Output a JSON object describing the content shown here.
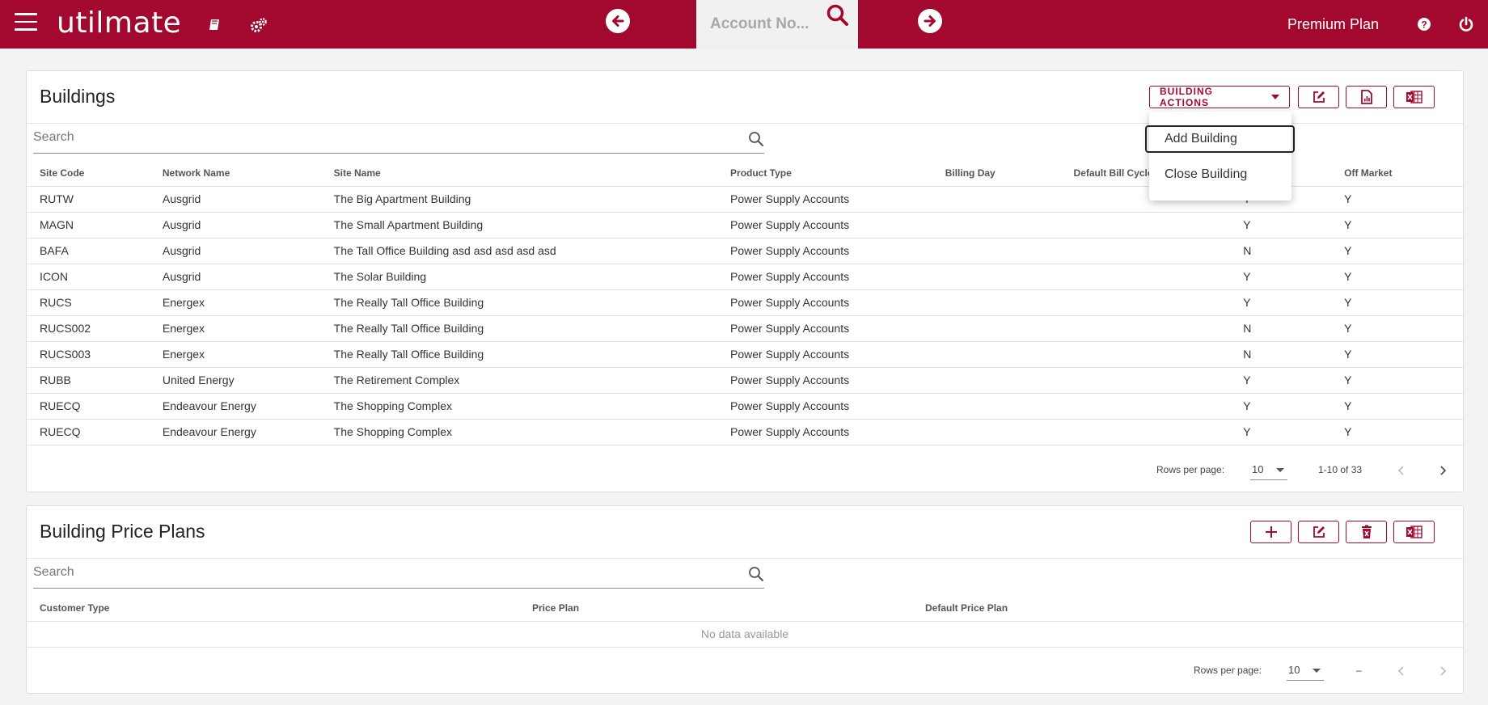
{
  "app": {
    "brand": "utilmate",
    "account_search_placeholder": "Account No...",
    "plan_label": "Premium Plan"
  },
  "buildings": {
    "title": "Buildings",
    "actions_label": "BUILDING ACTIONS",
    "search_placeholder": "Search",
    "columns": [
      "Site Code",
      "Network Name",
      "Site Name",
      "Product Type",
      "Billing Day",
      "Default Bill Cycle",
      "",
      "Off Market"
    ],
    "rows": [
      [
        "RUTW",
        "Ausgrid",
        "The Big Apartment Building",
        "Power Supply Accounts",
        "",
        "",
        "Y",
        "Y"
      ],
      [
        "MAGN",
        "Ausgrid",
        "The Small Apartment Building",
        "Power Supply Accounts",
        "",
        "",
        "Y",
        "Y"
      ],
      [
        "BAFA",
        "Ausgrid",
        "The Tall Office Building asd asd asd asd asd",
        "Power Supply Accounts",
        "",
        "",
        "N",
        "Y"
      ],
      [
        "ICON",
        "Ausgrid",
        "The Solar Building",
        "Power Supply Accounts",
        "",
        "",
        "Y",
        "Y"
      ],
      [
        "RUCS",
        "Energex",
        "The Really Tall Office Building",
        "Power Supply Accounts",
        "",
        "",
        "Y",
        "Y"
      ],
      [
        "RUCS002",
        "Energex",
        "The Really Tall Office Building",
        "Power Supply Accounts",
        "",
        "",
        "N",
        "Y"
      ],
      [
        "RUCS003",
        "Energex",
        "The Really Tall Office Building",
        "Power Supply Accounts",
        "",
        "",
        "N",
        "Y"
      ],
      [
        "RUBB",
        "United Energy",
        "The Retirement Complex",
        "Power Supply Accounts",
        "",
        "",
        "Y",
        "Y"
      ],
      [
        "RUECQ",
        "Endeavour Energy",
        "The Shopping Complex",
        "Power Supply Accounts",
        "",
        "",
        "Y",
        "Y"
      ],
      [
        "RUECQ",
        "Endeavour Energy",
        "The Shopping Complex",
        "Power Supply Accounts",
        "",
        "",
        "Y",
        "Y"
      ]
    ],
    "rows_per_page_label": "Rows per page:",
    "rows_per_page_value": "10",
    "range_text": "1-10 of 33"
  },
  "menu": {
    "items": [
      "Add Building",
      "Close Building"
    ]
  },
  "price_plans": {
    "title": "Building Price Plans",
    "search_placeholder": "Search",
    "columns": [
      "Customer Type",
      "Price Plan",
      "Default Price Plan"
    ],
    "no_data": "No data available",
    "rows_per_page_label": "Rows per page:",
    "rows_per_page_value": "10",
    "range_text": "–"
  },
  "colors": {
    "brand": "#a3092f"
  },
  "icons": [
    "menu-icon",
    "book-icon",
    "settings-icon",
    "arrow-left-icon",
    "search-icon",
    "arrow-right-icon",
    "help-icon",
    "power-icon",
    "edit-icon",
    "report-icon",
    "excel-icon",
    "add-icon",
    "delete-icon",
    "chevron-left-icon",
    "chevron-right-icon"
  ]
}
